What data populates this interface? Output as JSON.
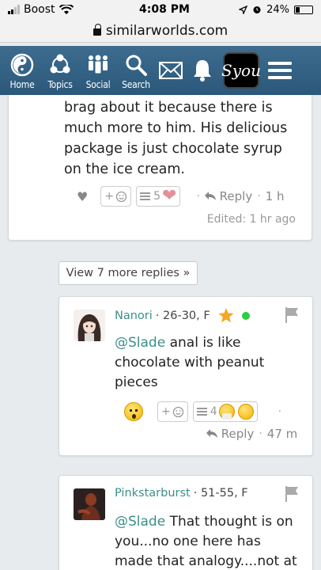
{
  "status_bar": {
    "carrier": "Boost",
    "time": "4:08 PM",
    "battery": "24%"
  },
  "url_bar": {
    "domain": "similarworlds.com"
  },
  "nav": {
    "items": [
      {
        "label": "Home",
        "icon": "yin-yang-icon"
      },
      {
        "label": "Topics",
        "icon": "topics-icon"
      },
      {
        "label": "Social",
        "icon": "people-icon"
      },
      {
        "label": "Search",
        "icon": "search-icon"
      }
    ],
    "syou": "Syou"
  },
  "comment1": {
    "text": "brag about it because there is much more to him. His delicious package is just chocolate syrup on the ice cream.",
    "plus_label": "+",
    "count": "5",
    "reply_label": "Reply",
    "time": "1 h",
    "edited": "Edited: 1 hr ago"
  },
  "view_more": "View 7 more replies »",
  "comment2": {
    "username": "Nanori",
    "meta": "· 26-30, F",
    "mention": "@Slade",
    "text": " anal is like chocolate with peanut pieces",
    "plus_label": "+",
    "count": "4",
    "reply_label": "Reply",
    "time": "47 m"
  },
  "comment3": {
    "username": "Pinkstarburst",
    "meta": "· 51-55, F",
    "mention": "@Slade",
    "text": " That thought is on you...no one here has made that analogy....not at"
  },
  "colors": {
    "nav_bg": "#2f5d80",
    "link_teal": "#3a8f8a",
    "heart_pink": "#e58f9b",
    "online_green": "#2ecc40",
    "star": "#f5a623"
  }
}
